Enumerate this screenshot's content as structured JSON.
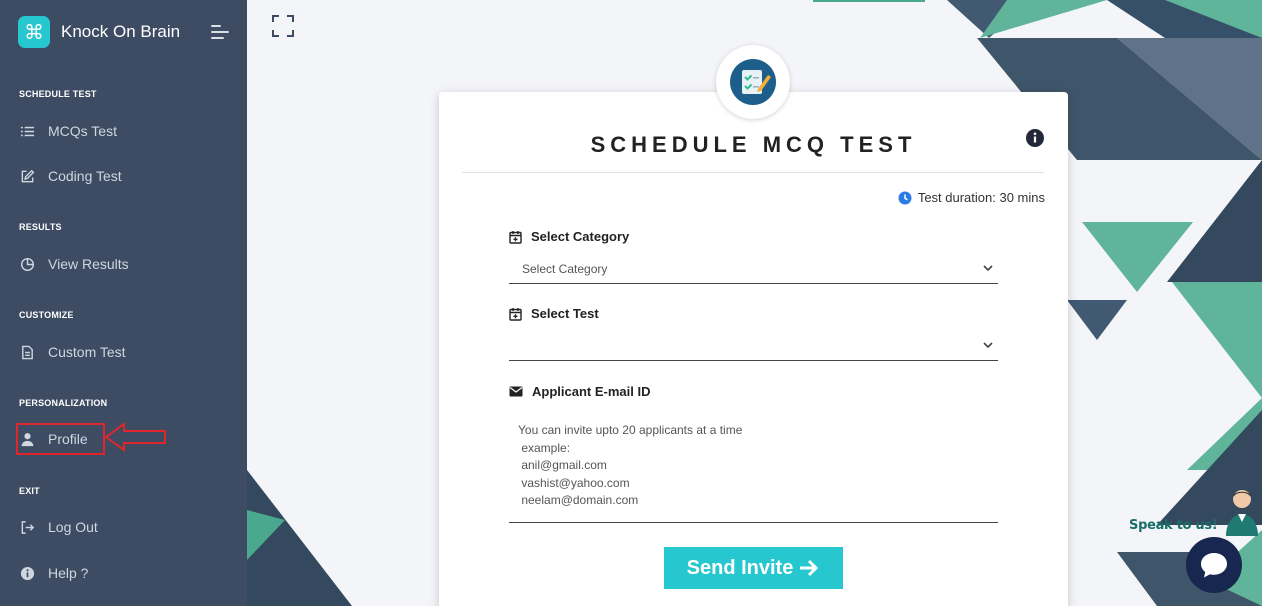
{
  "app": {
    "name": "Knock On Brain"
  },
  "sidebar": {
    "sections": [
      {
        "title": "SCHEDULE TEST",
        "items": [
          {
            "label": "MCQs Test",
            "icon": "list-icon"
          },
          {
            "label": "Coding Test",
            "icon": "edit-icon"
          }
        ]
      },
      {
        "title": "RESULTS",
        "items": [
          {
            "label": "View Results",
            "icon": "pie-chart-icon"
          }
        ]
      },
      {
        "title": "CUSTOMIZE",
        "items": [
          {
            "label": "Custom Test",
            "icon": "document-icon"
          }
        ]
      },
      {
        "title": "PERSONALIZATION",
        "items": [
          {
            "label": "Profile",
            "icon": "user-icon"
          }
        ]
      },
      {
        "title": "EXIT",
        "items": [
          {
            "label": "Log Out",
            "icon": "logout-icon"
          },
          {
            "label": "Help ?",
            "icon": "info-circle-icon"
          }
        ]
      }
    ]
  },
  "form": {
    "title": "SCHEDULE MCQ TEST",
    "duration": "Test duration: 30 mins",
    "category_label": "Select Category",
    "category_value": "Select Category",
    "test_label": "Select Test",
    "test_value": "",
    "email_label": "Applicant E-mail ID",
    "email_placeholder_lines": [
      "You can invite upto 20 applicants at a time",
      " example:",
      " anil@gmail.com",
      " vashist@yahoo.com",
      " neelam@domain.com"
    ],
    "send_button": "Send Invite"
  },
  "chat": {
    "prompt": "Speak to us!"
  },
  "colors": {
    "sidebar_bg": "#3d4c63",
    "accent": "#27c7cf",
    "annotation_red": "#e0262c",
    "chat_bg": "#17274f"
  }
}
